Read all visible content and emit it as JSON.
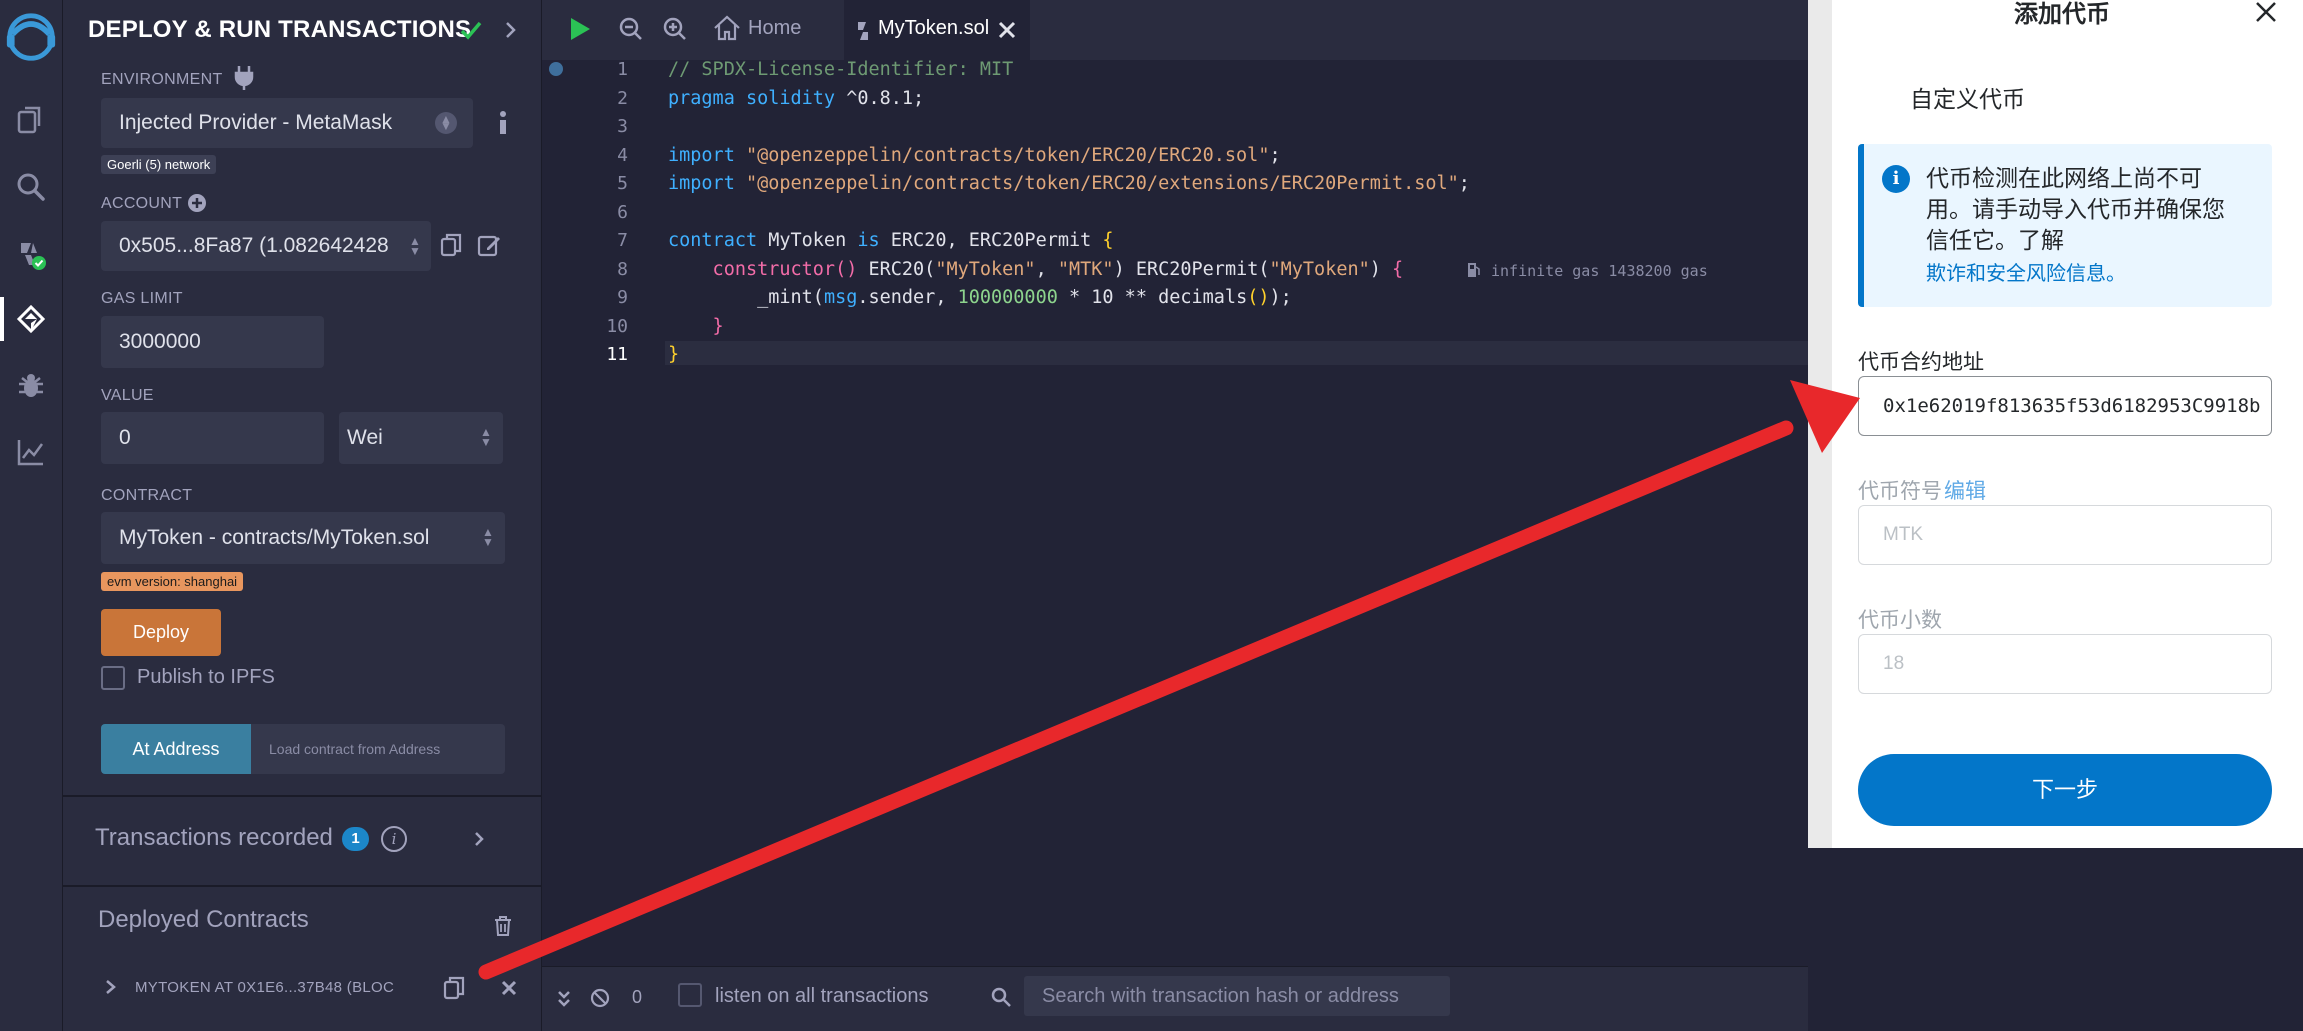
{
  "panel": {
    "title": "DEPLOY & RUN TRANSACTIONS",
    "environment_label": "ENVIRONMENT",
    "environment_value": "Injected Provider - MetaMask",
    "network_badge": "Goerli (5) network",
    "account_label": "ACCOUNT",
    "account_value": "0x505...8Fa87 (1.082642428",
    "gas_limit_label": "GAS LIMIT",
    "gas_limit_value": "3000000",
    "value_label": "VALUE",
    "value_amount": "0",
    "value_unit": "Wei",
    "contract_label": "CONTRACT",
    "contract_value": "MyToken - contracts/MyToken.sol",
    "evm_badge": "evm version: shanghai",
    "deploy_button": "Deploy",
    "publish_ipfs_label": "Publish to IPFS",
    "at_address_button": "At Address",
    "load_contract_placeholder": "Load contract from Address",
    "transactions_recorded_label": "Transactions recorded",
    "transactions_recorded_count": "1",
    "deployed_contracts_label": "Deployed Contracts",
    "deployed_item": "MYTOKEN AT 0X1E6...37B48 (BLOC"
  },
  "tabs": {
    "home": "Home",
    "file": "MyToken.sol"
  },
  "code": {
    "gutter": [
      "1",
      "2",
      "3",
      "4",
      "5",
      "6",
      "7",
      "8",
      "9",
      "10",
      "11"
    ],
    "l1": "// SPDX-License-Identifier: MIT",
    "l2a": "pragma solidity",
    "l2b": " ^0.8.1;",
    "l4a": "import ",
    "l4b": "\"@openzeppelin/contracts/token/ERC20/ERC20.sol\"",
    "l4c": ";",
    "l5a": "import ",
    "l5b": "\"@openzeppelin/contracts/token/ERC20/extensions/ERC20Permit.sol\"",
    "l5c": ";",
    "l7a": "contract",
    "l7b": " MyToken ",
    "l7c": "is",
    "l7d": " ERC20, ERC20Permit ",
    "l7e": "{",
    "l8a": "    constructor",
    "l8b": "()",
    "l8c": " ERC20(",
    "l8d": "\"MyToken\"",
    "l8e": ", ",
    "l8f": "\"MTK\"",
    "l8g": ") ERC20Permit(",
    "l8h": "\"MyToken\"",
    "l8i": ") ",
    "l8j": "{",
    "gas_hint": "infinite gas 1438200 gas",
    "l9a": "        _mint(",
    "l9b": "msg",
    "l9c": ".sender, ",
    "l9d": "100000000",
    "l9e": " * 10 ** decimals",
    "l9f": "()",
    "l9g": ");",
    "l10": "    }",
    "l11": "}"
  },
  "terminal": {
    "count": "0",
    "listen_label": "listen on all transactions",
    "search_placeholder": "Search with transaction hash or address"
  },
  "metamask": {
    "title": "添加代币",
    "custom_token_tab": "自定义代币",
    "notice_line1": "代币检测在此网络上尚不可",
    "notice_line2": "用。请手动导入代币并确保您",
    "notice_line3": "信任它。了解",
    "notice_link": "欺诈和安全风险信息。",
    "contract_address_label": "代币合约地址",
    "contract_address_value": "0x1e62019f813635f53d6182953C9918b",
    "symbol_label": "代币符号",
    "symbol_edit": "编辑",
    "symbol_value": "MTK",
    "decimals_label": "代币小数",
    "decimals_value": "18",
    "next_button": "下一步"
  },
  "colors": {
    "accent_blue": "#0376c9",
    "remix_bg": "#222336",
    "deploy_orange": "#c97539",
    "arrow_red": "#e8282b"
  }
}
